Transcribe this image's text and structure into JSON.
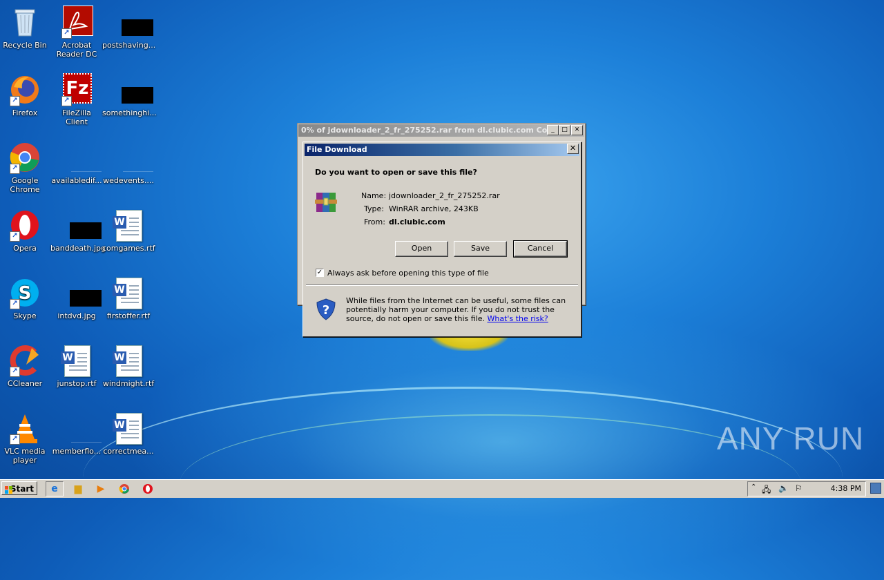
{
  "desktop": {
    "icons": [
      {
        "label": "Recycle Bin",
        "icon": "recycle-bin-icon"
      },
      {
        "label": "Acrobat Reader DC",
        "icon": "acrobat-icon"
      },
      {
        "label": "postshaving...",
        "icon": "image-thumbnail"
      },
      {
        "label": "Firefox",
        "icon": "firefox-icon"
      },
      {
        "label": "FileZilla Client",
        "icon": "filezilla-icon"
      },
      {
        "label": "somethinghi...",
        "icon": "image-thumbnail"
      },
      {
        "label": "Google Chrome",
        "icon": "chrome-icon"
      },
      {
        "label": "availabledif...",
        "icon": "file-icon"
      },
      {
        "label": "wedevents....",
        "icon": "file-icon"
      },
      {
        "label": "Opera",
        "icon": "opera-icon"
      },
      {
        "label": "banddeath.jpg",
        "icon": "image-thumbnail"
      },
      {
        "label": "comgames.rtf",
        "icon": "word-doc-icon"
      },
      {
        "label": "Skype",
        "icon": "skype-icon"
      },
      {
        "label": "intdvd.jpg",
        "icon": "image-thumbnail"
      },
      {
        "label": "firstoffer.rtf",
        "icon": "word-doc-icon"
      },
      {
        "label": "CCleaner",
        "icon": "ccleaner-icon"
      },
      {
        "label": "junstop.rtf",
        "icon": "word-doc-icon"
      },
      {
        "label": "windmight.rtf",
        "icon": "word-doc-icon"
      },
      {
        "label": "VLC media player",
        "icon": "vlc-icon"
      },
      {
        "label": "memberflo...",
        "icon": "file-icon"
      },
      {
        "label": "correctmea...",
        "icon": "word-doc-icon"
      }
    ]
  },
  "background_window": {
    "title": "0% of jdownloader_2_fr_275252.rar from dl.clubic.com Comp..."
  },
  "dialog": {
    "title": "File Download",
    "question": "Do you want to open or save this file?",
    "name_label": "Name:",
    "name_value": "jdownloader_2_fr_275252.rar",
    "type_label": "Type:",
    "type_value": "WinRAR archive, 243KB",
    "from_label": "From:",
    "from_value": "dl.clubic.com",
    "open_button": "Open",
    "save_button": "Save",
    "cancel_button": "Cancel",
    "checkbox_label": "Always ask before opening this type of file",
    "checkbox_checked": true,
    "warning_text": "While files from the Internet can be useful, some files can potentially harm your computer. If you do not trust the source, do not open or save this file.",
    "risk_link": "What's the risk?"
  },
  "taskbar": {
    "start_label": "Start",
    "clock": "4:38 PM"
  },
  "watermark": "ANY RUN"
}
